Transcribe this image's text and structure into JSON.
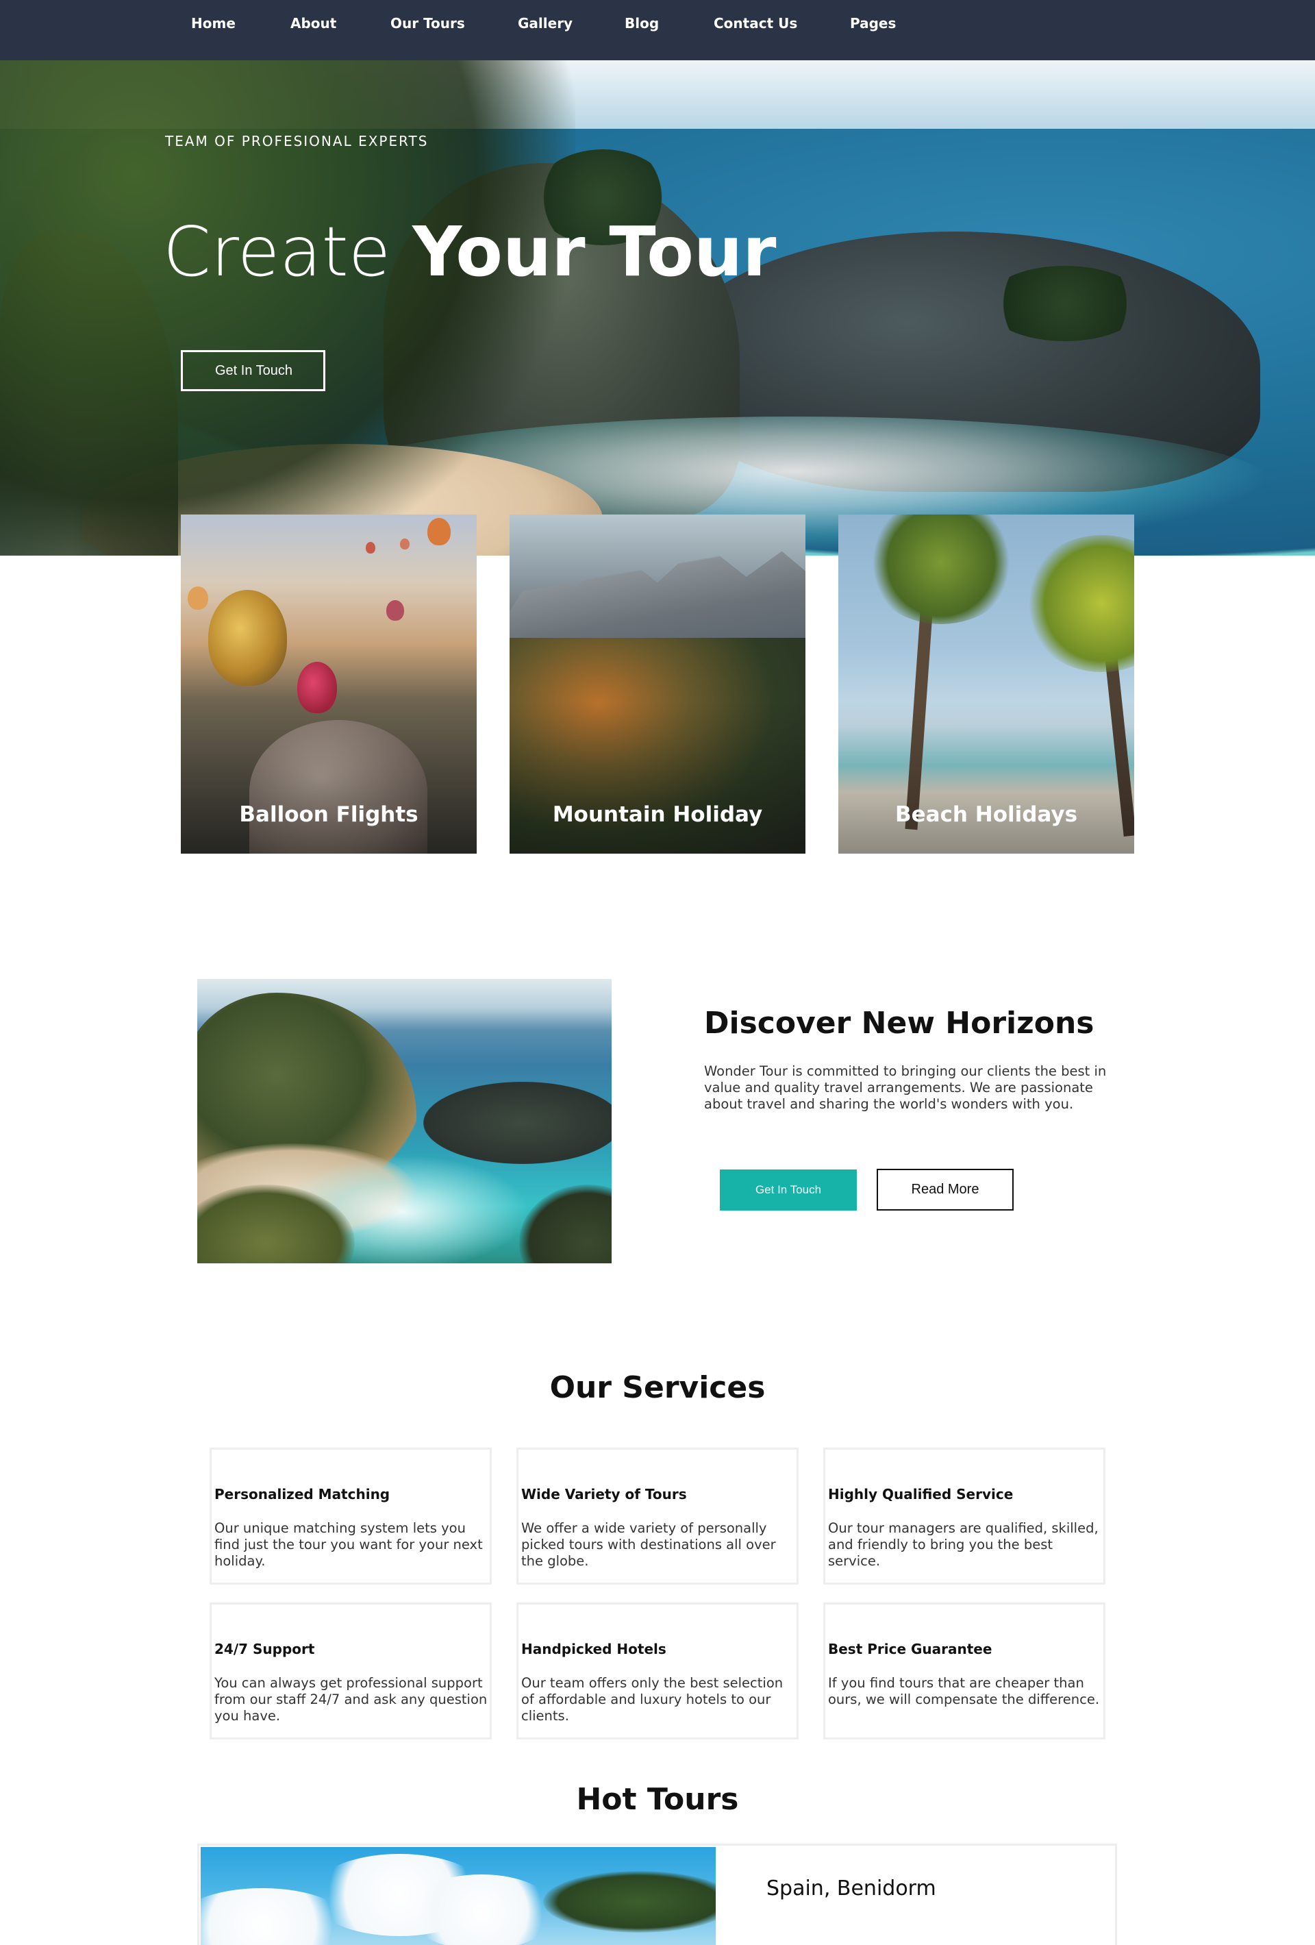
{
  "nav": {
    "items": [
      "Home",
      "About",
      "Our Tours",
      "Gallery",
      "Blog",
      "Contact Us",
      "Pages"
    ]
  },
  "hero": {
    "kicker": "TEAM OF PROFESIONAL EXPERTS",
    "title_light": "Create",
    "title_bold": "Your Tour",
    "button": "Get In Touch"
  },
  "categories": [
    {
      "label": "Balloon Flights"
    },
    {
      "label": "Mountain Holiday"
    },
    {
      "label": "Beach Holidays"
    }
  ],
  "discover": {
    "title": "Discover New Horizons",
    "text": "Wonder Tour is committed to bringing our clients the best in value and quality travel arrangements. We are passionate about travel and sharing the world's wonders with you.",
    "primary_button": "Get In Touch",
    "secondary_button": "Read More"
  },
  "services": {
    "title": "Our Services",
    "items": [
      {
        "title": "Personalized Matching",
        "text": "Our unique matching system lets you find just the tour you want for your next holiday."
      },
      {
        "title": "Wide Variety of Tours",
        "text": "We offer a wide variety of personally picked tours with destinations all over the globe."
      },
      {
        "title": "Highly Qualified Service",
        "text": "Our tour managers are qualified, skilled, and friendly to bring you the best service."
      },
      {
        "title": "24/7 Support",
        "text": "You can always get professional support from our staff 24/7 and ask any question you have."
      },
      {
        "title": "Handpicked Hotels",
        "text": "Our team offers only the best selection of affordable and luxury hotels to our clients."
      },
      {
        "title": "Best Price Guarantee",
        "text": "If you find tours that are cheaper than ours, we will compensate the difference."
      }
    ]
  },
  "hot_tours": {
    "title": "Hot Tours",
    "items": [
      {
        "name": "Spain, Benidorm"
      }
    ]
  },
  "colors": {
    "nav_bg": "#2b3346",
    "accent_teal": "#17b3a9",
    "text_dark": "#111111",
    "card_border": "#eeeeee"
  }
}
